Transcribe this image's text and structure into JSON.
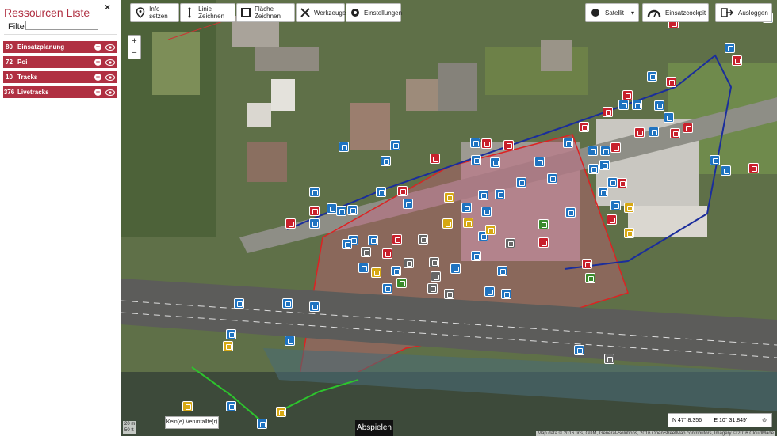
{
  "sidebar": {
    "title": "Ressourcen Liste",
    "close_icon": "×",
    "filter_label": "Filter",
    "filter_value": "",
    "groups": [
      {
        "count": "80",
        "label": "Einsatzplanung"
      },
      {
        "count": "72",
        "label": "Poi"
      },
      {
        "count": "10",
        "label": "Tracks"
      },
      {
        "count": "376",
        "label": "Livetracks"
      }
    ]
  },
  "toolbar": {
    "info": "Info setzen",
    "line": "Linie Zeichnen",
    "area": "Fläche Zeichnen",
    "tools": "Werkzeuge",
    "settings": "Einstellungen",
    "layer": "Satellit",
    "cockpit": "Einsatzcockpit",
    "logout": "Ausloggen"
  },
  "zoom": {
    "plus": "+",
    "minus": "−"
  },
  "map": {
    "popup": "Kein(e) Verunfallte(r)",
    "play": "Abspielen",
    "coord_lat": "N 47° 8.356'",
    "coord_lon": "E 10° 31.849'",
    "scale_top": "20 m",
    "scale_bottom": "50 ft",
    "attribution": "Map data © 2016 tiris, GDM, General-Solutions, 2016 OpenStreetMap contributors, Imagery © 2016 CloudMade"
  },
  "colors": {
    "brand": "#b03042",
    "marker_blue": "#1f73c0",
    "marker_red": "#c8202c"
  }
}
